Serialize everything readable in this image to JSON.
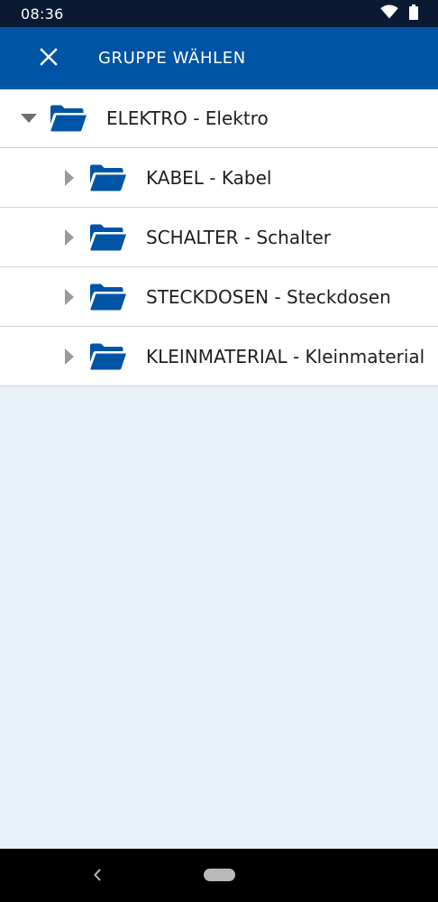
{
  "status_bar": {
    "time": "08:36"
  },
  "app_bar": {
    "title": "GRUPPE WÄHLEN"
  },
  "tree": {
    "root": {
      "label": "ELEKTRO - Elektro"
    },
    "children": [
      {
        "label": "KABEL - Kabel"
      },
      {
        "label": "SCHALTER - Schalter"
      },
      {
        "label": "STECKDOSEN - Steckdosen"
      },
      {
        "label": "KLEINMATERIAL - Kleinmaterial"
      }
    ]
  },
  "colors": {
    "app_bar": "#0054a6",
    "folder": "#0054a6",
    "status_bar": "#0b1a33",
    "background": "#e8f0f8"
  },
  "icons": {
    "close": "close-icon",
    "folder": "folder-icon",
    "expanded": "caret-down-icon",
    "collapsed": "caret-right-icon"
  }
}
